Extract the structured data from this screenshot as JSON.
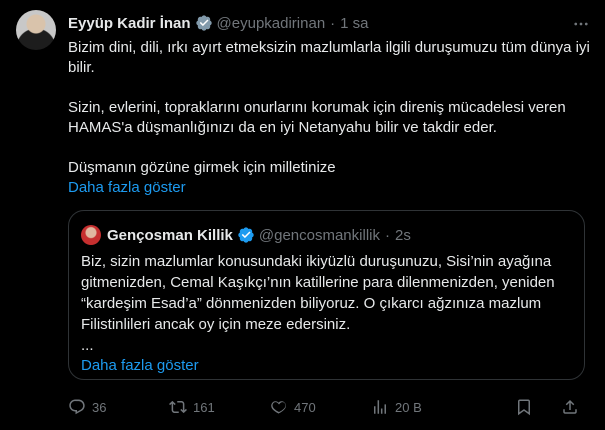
{
  "author": {
    "name": "Eyyüp Kadir İnan",
    "handle": "@eyupkadirinan",
    "time": "1 sa"
  },
  "tweet": {
    "paragraphs": [
      "Bizim dini, dili, ırkı ayırt etmeksizin mazlumlarla ilgili duruşumuzu tüm dünya iyi bilir.",
      "Sizin, evlerini, topraklarını onurlarını korumak için direniş mücadelesi veren HAMAS'a düşmanlığınızı da en iyi Netanyahu bilir ve takdir eder.",
      "Düşmanın gözüne girmek için milletinize"
    ],
    "show_more": "Daha fazla göster"
  },
  "quoted": {
    "name": "Gençosman Killik",
    "handle": "@gencosmankillik",
    "time": "2s",
    "text": "Biz, sizin mazlumlar konusundaki ikiyüzlü duruşunuzu, Sisi’nin ayağına gitmenizden, Cemal Kaşıkçı’nın katillerine para dilenmenizden, yeniden “kardeşim Esad’a” dönmenizden biliyoruz. O çıkarcı ağzınıza mazlum Filistinlileri ancak oy için meze edersiniz.",
    "ellipsis": "...",
    "show_more": "Daha fazla göster"
  },
  "actions": {
    "replies": "36",
    "retweets": "161",
    "likes": "470",
    "views": "20 B"
  },
  "colors": {
    "background": "#000000",
    "text": "#e7e9ea",
    "muted": "#71767b",
    "link": "#1d9bf0",
    "verified": "#1d9bf0",
    "border": "#2f3336"
  },
  "icons": [
    "verified-badge-icon",
    "more-icon",
    "reply-icon",
    "retweet-icon",
    "like-icon",
    "views-icon",
    "bookmark-icon",
    "share-icon"
  ]
}
